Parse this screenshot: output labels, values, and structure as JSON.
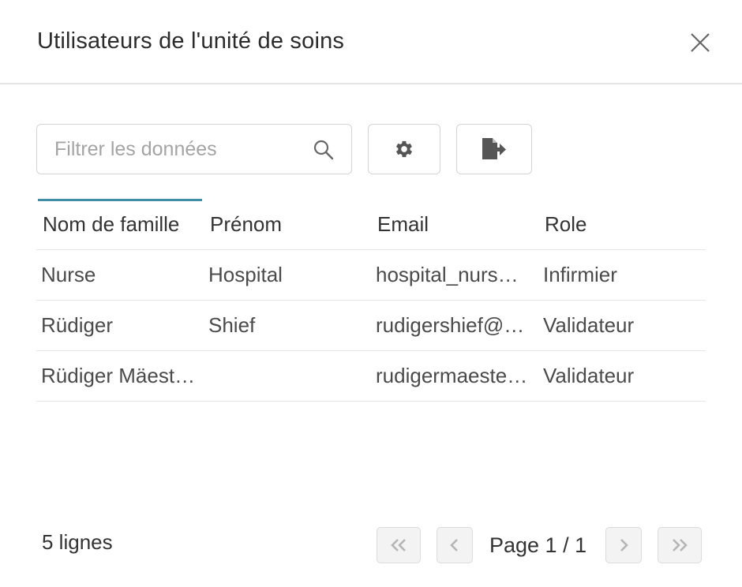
{
  "dialog": {
    "title": "Utilisateurs de l'unité de soins"
  },
  "toolbar": {
    "search_placeholder": "Filtrer les données",
    "search_value": ""
  },
  "table": {
    "columns": [
      "Nom de famille",
      "Prénom",
      "Email",
      "Role"
    ],
    "sorted_column": "Nom de famille",
    "rows": [
      [
        "Nurse",
        "Hospital",
        "hospital_nurs…",
        "Infirmier"
      ],
      [
        "Rüdiger",
        "Shief",
        "rudigershief@…",
        "Validateur"
      ],
      [
        "Rüdiger Mäest…",
        "",
        "rudigermaeste…",
        "Validateur"
      ]
    ]
  },
  "footer": {
    "row_count": "5 lignes",
    "page_label": "Page 1 / 1"
  },
  "colors": {
    "accent": "#3f8ea6",
    "icon": "#555555"
  }
}
